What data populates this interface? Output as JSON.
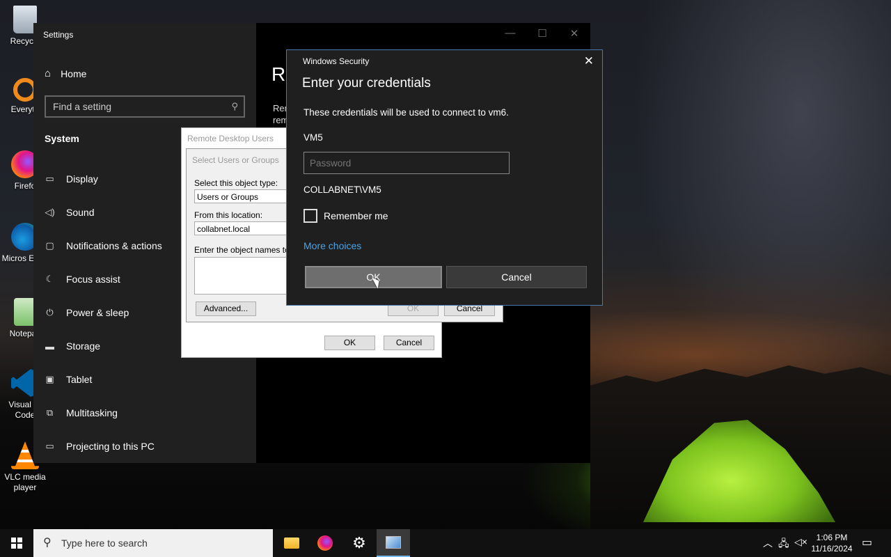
{
  "desktop": {
    "icons": [
      {
        "label": "Recycle",
        "icon": "recycle-bin-icon"
      },
      {
        "label": "Everyth",
        "icon": "everything-search-icon"
      },
      {
        "label": "Firefo",
        "icon": "firefox-icon"
      },
      {
        "label": "Micros Edge",
        "icon": "edge-icon"
      },
      {
        "label": "Notepac",
        "icon": "notepad-icon"
      },
      {
        "label": "Visual St Code",
        "icon": "vscode-icon"
      },
      {
        "label": "VLC media player",
        "icon": "vlc-icon"
      }
    ]
  },
  "settings": {
    "title": "Settings",
    "home": "Home",
    "search_placeholder": "Find a setting",
    "section": "System",
    "nav": [
      {
        "label": "Display",
        "icon": "monitor-icon"
      },
      {
        "label": "Sound",
        "icon": "speaker-icon"
      },
      {
        "label": "Notifications & actions",
        "icon": "notification-icon"
      },
      {
        "label": "Focus assist",
        "icon": "moon-icon"
      },
      {
        "label": "Power & sleep",
        "icon": "power-icon"
      },
      {
        "label": "Storage",
        "icon": "storage-icon"
      },
      {
        "label": "Tablet",
        "icon": "tablet-icon"
      },
      {
        "label": "Multitasking",
        "icon": "multitasking-icon"
      },
      {
        "label": "Projecting to this PC",
        "icon": "projecting-icon"
      }
    ],
    "right_heading": "Re",
    "right_text_1": "Rem",
    "right_text_2": "rem"
  },
  "remote_desktop_users": {
    "title": "Remote Desktop Users",
    "ok": "OK",
    "cancel": "Cancel"
  },
  "select_users": {
    "title": "Select Users or Groups",
    "object_type_label": "Select this object type:",
    "object_type_value": "Users or Groups",
    "location_label": "From this location:",
    "location_value": "collabnet.local",
    "names_label": "Enter the object names to se",
    "advanced": "Advanced...",
    "ok": "OK",
    "cancel": "Cancel"
  },
  "windows_security": {
    "app": "Windows Security",
    "heading": "Enter your credentials",
    "description": "These credentials will be used to connect to vm6.",
    "username": "VM5",
    "password_placeholder": "Password",
    "domain_user": "COLLABNET\\VM5",
    "remember_me": "Remember me",
    "more_choices": "More choices",
    "ok": "OK",
    "cancel": "Cancel"
  },
  "taskbar": {
    "search_placeholder": "Type here to search",
    "apps": [
      "file-explorer-icon",
      "firefox-icon",
      "settings-gear-icon",
      "remote-desktop-icon"
    ],
    "time": "1:06 PM",
    "date": "11/16/2024"
  },
  "colors": {
    "accent_link": "#4aa3e8",
    "dialog_border": "#4a78b0"
  }
}
